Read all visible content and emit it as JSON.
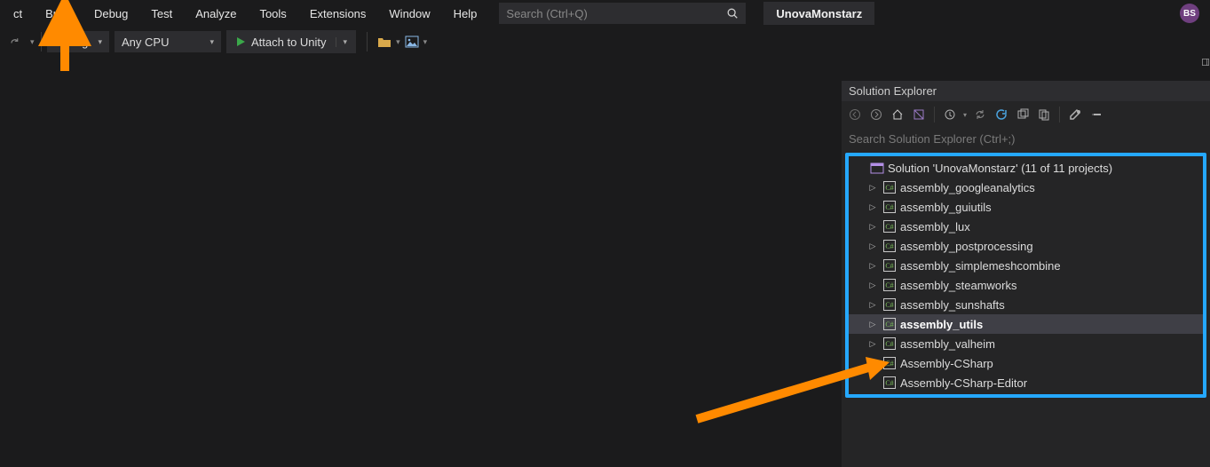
{
  "menu": {
    "items": [
      "ct",
      "Build",
      "Debug",
      "Test",
      "Analyze",
      "Tools",
      "Extensions",
      "Window",
      "Help"
    ]
  },
  "search": {
    "placeholder": "Search (Ctrl+Q)"
  },
  "project": {
    "name": "UnovaMonstarz"
  },
  "user": {
    "initials": "BS"
  },
  "toolbar": {
    "config": "Debug",
    "platform": "Any CPU",
    "attach": "Attach to Unity"
  },
  "solution_explorer": {
    "title": "Solution Explorer",
    "search_placeholder": "Search Solution Explorer (Ctrl+;)",
    "root": "Solution 'UnovaMonstarz' (11 of 11 projects)",
    "items": [
      {
        "label": "assembly_googleanalytics",
        "expandable": true
      },
      {
        "label": "assembly_guiutils",
        "expandable": true
      },
      {
        "label": "assembly_lux",
        "expandable": true
      },
      {
        "label": "assembly_postprocessing",
        "expandable": true
      },
      {
        "label": "assembly_simplemeshcombine",
        "expandable": true
      },
      {
        "label": "assembly_steamworks",
        "expandable": true
      },
      {
        "label": "assembly_sunshafts",
        "expandable": true
      },
      {
        "label": "assembly_utils",
        "expandable": true,
        "selected": true
      },
      {
        "label": "assembly_valheim",
        "expandable": true
      },
      {
        "label": "Assembly-CSharp",
        "expandable": false
      },
      {
        "label": "Assembly-CSharp-Editor",
        "expandable": false
      }
    ]
  },
  "annotations": {
    "arrow_to_build": true,
    "arrow_to_assembly_csharp": true,
    "highlight_solution_tree": true
  },
  "colors": {
    "accent_blue": "#25a8ff",
    "annotation_orange": "#ff8a00"
  }
}
